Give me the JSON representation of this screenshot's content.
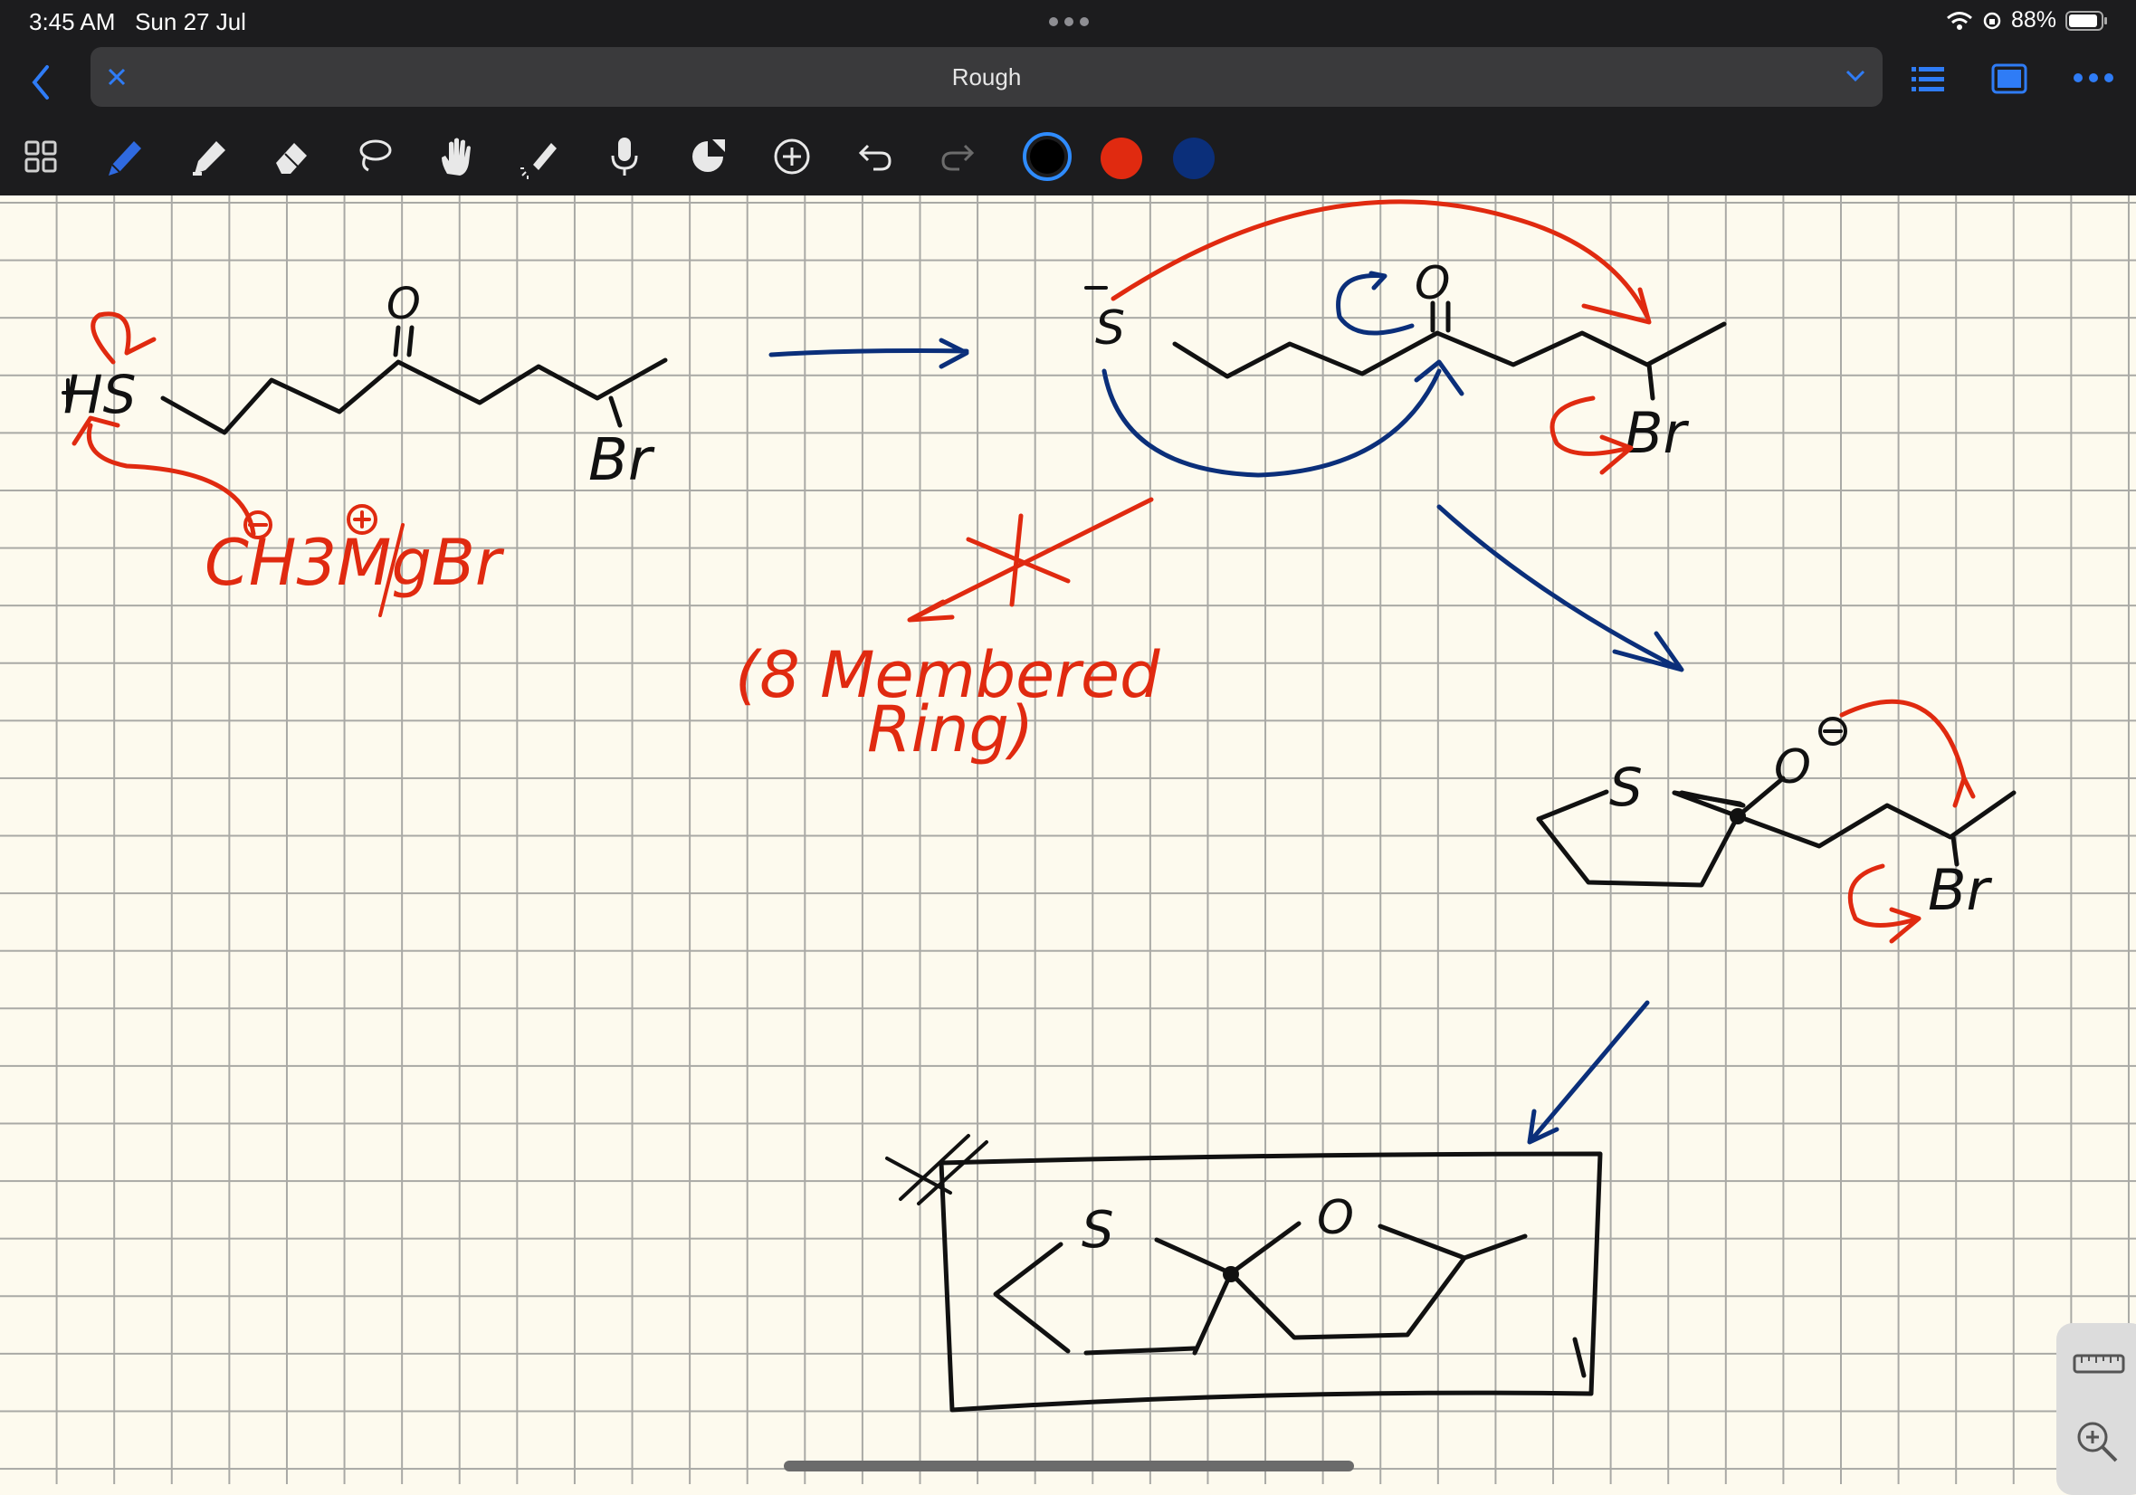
{
  "status_bar": {
    "time": "3:45 AM",
    "date": "Sun 27 Jul",
    "battery": "88%"
  },
  "nav": {
    "document_title": "Rough"
  },
  "toolbar": {
    "tools": [
      "grid-view",
      "pen",
      "highlighter",
      "eraser",
      "lasso",
      "hand",
      "laser-pointer",
      "microphone",
      "shapes",
      "add",
      "undo",
      "redo"
    ],
    "colors": [
      "#000000",
      "#e02a10",
      "#0b2f7a"
    ],
    "selected_color": "#000000"
  },
  "canvas": {
    "background": "grid paper",
    "texts": {
      "hs": "HS",
      "o1": "O",
      "br1": "Br",
      "reagent": "CH3MgBr",
      "s2": "S",
      "o2": "O",
      "br2": "Br",
      "note_line1": "(8 Membered",
      "note_line2": "Ring)",
      "s3": "S",
      "o3": "O",
      "br3": "Br",
      "s4": "S",
      "o4": "O"
    }
  }
}
